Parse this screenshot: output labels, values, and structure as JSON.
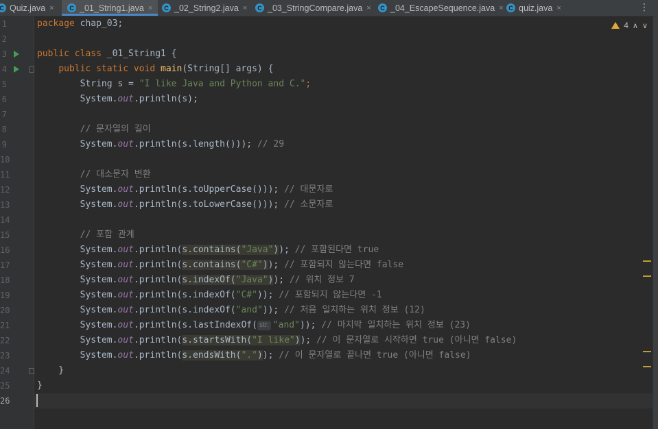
{
  "tabs": [
    {
      "label": "Quiz.java",
      "active": false,
      "icon": "java-class-icon"
    },
    {
      "label": "_01_String1.java",
      "active": true,
      "icon": "java-class-icon"
    },
    {
      "label": "_02_String2.java",
      "active": false,
      "icon": "java-class-icon"
    },
    {
      "label": "_03_StringCompare.java",
      "active": false,
      "icon": "java-class-icon"
    },
    {
      "label": "_04_EscapeSequence.java",
      "active": false,
      "icon": "java-class-icon"
    },
    {
      "label": "quiz.java",
      "active": false,
      "icon": "java-class-icon"
    }
  ],
  "tab_icon_glyph": "C",
  "tab_close_glyph": "×",
  "more_glyph": "⋮",
  "inspections": {
    "warning_count": "4",
    "up_glyph": "∧",
    "down_glyph": "∨"
  },
  "line_numbers": [
    "1",
    "2",
    "3",
    "4",
    "5",
    "6",
    "7",
    "8",
    "9",
    "10",
    "11",
    "12",
    "13",
    "14",
    "15",
    "16",
    "17",
    "18",
    "19",
    "20",
    "21",
    "22",
    "23",
    "24",
    "25",
    "26"
  ],
  "current_line": "26",
  "code": {
    "l1_kw": "package",
    "l1_rest": " chap_03;",
    "l3_kw": "public class",
    "l3_rest": " _01_String1 {",
    "l4_indent": "    ",
    "l4_kw": "public static void",
    "l4_fn": "main",
    "l4_rest": "(String[] args) {",
    "l5_a": "        String s = ",
    "l5_str": "\"I like Java and Python and C.\"",
    "l5_b": ";",
    "l6": "        System.out.println(s);",
    "l8_cmt": "// 문자열의 길이",
    "l9_call": "System.out.println(s.length());",
    "l9_cmt": "// 29",
    "l11_cmt": "// 대소문자 변환",
    "l12_call": "System.out.println(s.toUpperCase());",
    "l12_cmt": "// 대문자로",
    "l13_call": "System.out.println(s.toLowerCase());",
    "l13_cmt": "// 소문자로",
    "l15_cmt": "// 포함 관계",
    "l16_m": "s.contains(",
    "l16_s": "\"Java\"",
    "l16_cmt": "// 포함된다면 true",
    "l17_m": "s.contains(",
    "l17_s": "\"C#\"",
    "l17_cmt": "// 포함되지 않는다면 false",
    "l18_m": "s.indexOf(",
    "l18_s": "\"Java\"",
    "l18_cmt": "// 위치 정보 7",
    "l19_m": "s.indexOf(",
    "l19_s": "\"C#\"",
    "l19_cmt": "// 포함되지 않는다면 -1",
    "l20_m": "s.indexOf(",
    "l20_s": "\"and\"",
    "l20_cmt": "// 처음 일치하는 위치 정보 (12)",
    "l21_m": "s.lastIndexOf(",
    "l21_hint": "str:",
    "l21_s": "\"and\"",
    "l21_cmt": "// 마지막 일치하는 위치 정보 (23)",
    "l22_m": "s.startsWith(",
    "l22_s": "\"I like\"",
    "l22_cmt": "// 이 문자열로 시작하면 true (아니면 false)",
    "l23_m": "s.endsWith(",
    "l23_s": "\".\"",
    "l23_cmt": "// 이 문자열로 끝나면 true (아니면 false)",
    "sys": "System.",
    "out": "out",
    "println": ".println(",
    "close": ");",
    "close2": "));",
    "l24": "    }",
    "l25": "}"
  },
  "colors": {
    "keyword": "#cc7832",
    "string": "#6a8759",
    "comment": "#808080",
    "field": "#9876aa",
    "method": "#ffc66d",
    "text": "#a9b7c6",
    "background": "#2b2b2b"
  }
}
